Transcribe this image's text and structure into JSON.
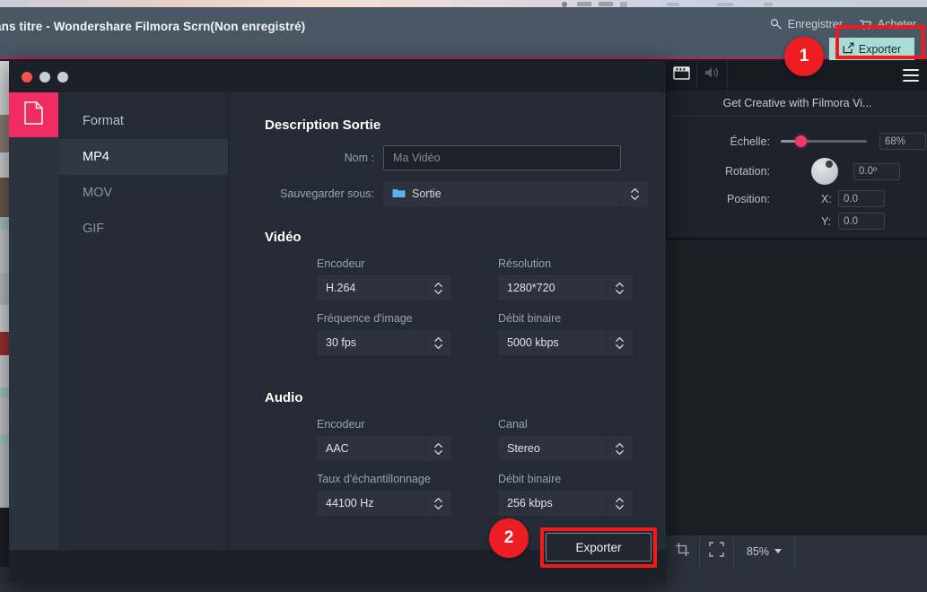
{
  "app": {
    "title": "ans titre - Wondershare Filmora Scrn(Non enregistré)",
    "actions": [
      {
        "label": "Enregistrer",
        "icon": "key-search-icon"
      },
      {
        "label": "Acheter",
        "icon": "cart-icon"
      }
    ],
    "export_chip": {
      "label": "Exporter",
      "icon": "export-icon",
      "color": "#a8dcd4"
    }
  },
  "right_dock": {
    "tabs": [
      {
        "icon": "clapboard-icon",
        "active": true
      },
      {
        "icon": "speaker-icon",
        "active": false
      }
    ],
    "menu_icon": "hamburger-menu-icon",
    "clip_title": "Get Creative with Filmora Vi...",
    "properties": {
      "scale_label": "Échelle:",
      "scale_value": "68%",
      "scale_percent": 30,
      "rotation_label": "Rotation:",
      "rotation_value": "0.0º",
      "position_label": "Position:",
      "x_label": "X:",
      "x_value": "0.0",
      "y_label": "Y:",
      "y_value": "0.0"
    }
  },
  "bottom_toolbar": {
    "crop_icon": "crop-icon",
    "fit_icon": "fit-to-screen-icon",
    "zoom_level": "85%",
    "zoom_caret": "chevron-down-icon"
  },
  "dialog": {
    "window_controls": [
      "close",
      "minimize",
      "maximize"
    ],
    "file_icon": "document-icon",
    "sidebar": [
      {
        "label": "Format",
        "state": "header"
      },
      {
        "label": "MP4",
        "state": "active"
      },
      {
        "label": "MOV",
        "state": "normal"
      },
      {
        "label": "GIF",
        "state": "normal"
      }
    ],
    "output": {
      "section_title": "Description Sortie",
      "name_label": "Nom :",
      "name_value": "Ma Vidéo",
      "name_placeholder": "Ma Vidéo",
      "folder_label": "Sauvegarder sous:",
      "folder_value": "Sortie",
      "folder_icon": "folder-icon"
    },
    "video": {
      "section_title": "Vidéo",
      "fields": [
        {
          "label": "Encodeur",
          "value": "H.264"
        },
        {
          "label": "Résolution",
          "value": "1280*720"
        },
        {
          "label": "Fréquence d'image",
          "value": "30 fps"
        },
        {
          "label": "Débit binaire",
          "value": "5000 kbps"
        }
      ]
    },
    "audio": {
      "section_title": "Audio",
      "fields": [
        {
          "label": "Encodeur",
          "value": "AAC"
        },
        {
          "label": "Canal",
          "value": "Stereo"
        },
        {
          "label": "Taux d'échantillonnage",
          "value": "44100 Hz"
        },
        {
          "label": "Débit binaire",
          "value": "256 kbps"
        }
      ]
    },
    "export_button": "Exporter"
  },
  "annotations": [
    {
      "number": "1",
      "target": "top-export-button"
    },
    {
      "number": "2",
      "target": "dialog-export-button"
    }
  ],
  "colors": {
    "accent_pink": "#f02c62",
    "annotation_red": "#ee1c23",
    "titlebar": "#4a5765",
    "dialog_bg": "#242b35",
    "export_chip": "#a8dcd4"
  }
}
